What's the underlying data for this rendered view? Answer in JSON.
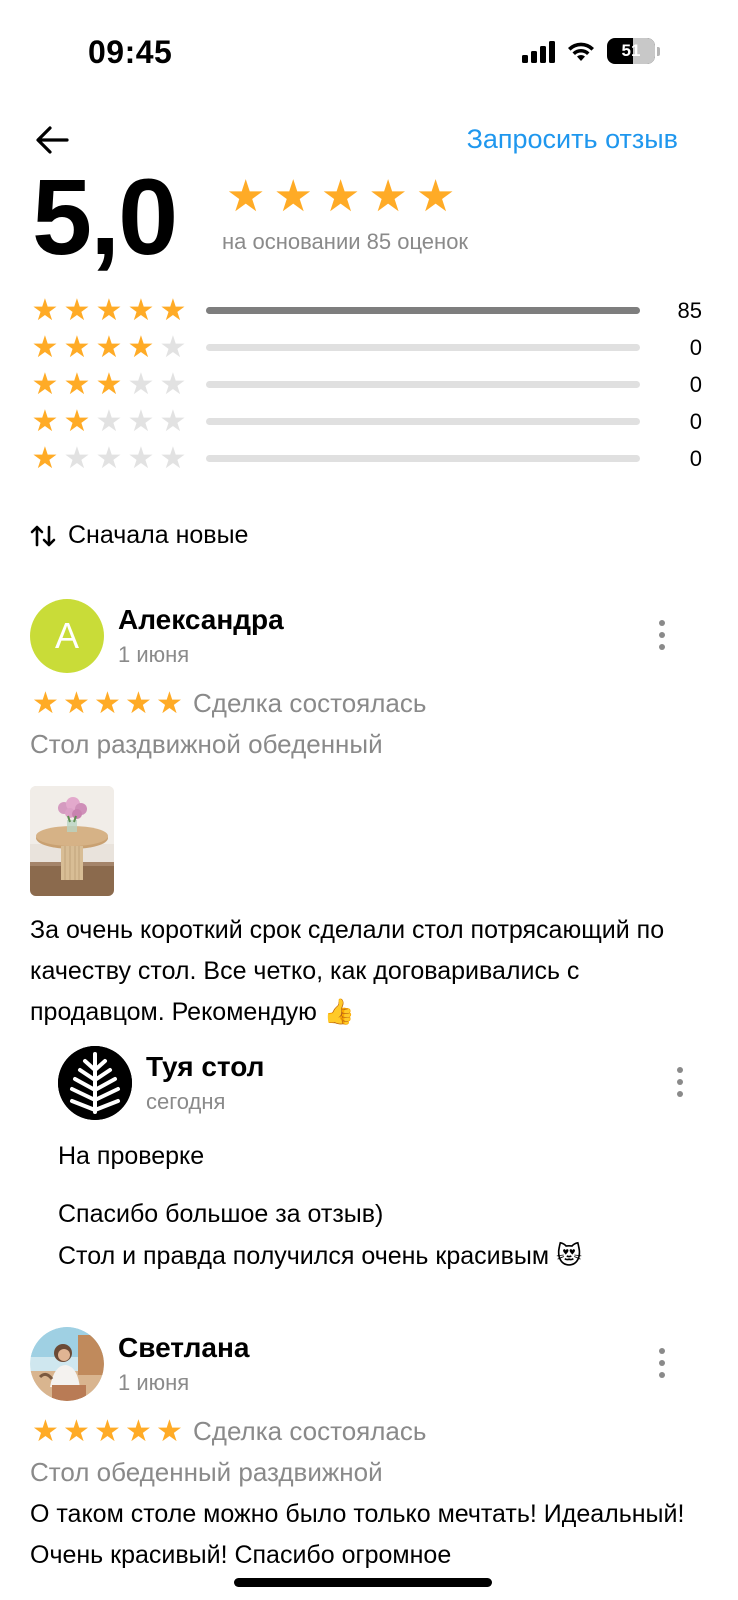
{
  "status_bar": {
    "time": "09:45",
    "battery": "51"
  },
  "header": {
    "request_review": "Запросить отзыв"
  },
  "summary": {
    "rating": "5,0",
    "stars": 5,
    "based_on": "на основании 85 оценок",
    "distribution": [
      {
        "stars": 5,
        "count": "85",
        "fraction": 1.0
      },
      {
        "stars": 4,
        "count": "0",
        "fraction": 0
      },
      {
        "stars": 3,
        "count": "0",
        "fraction": 0
      },
      {
        "stars": 2,
        "count": "0",
        "fraction": 0
      },
      {
        "stars": 1,
        "count": "0",
        "fraction": 0
      }
    ]
  },
  "sort": {
    "label": "Сначала новые"
  },
  "reviews": [
    {
      "avatar_letter": "А",
      "avatar_color": "#c9dc38",
      "author": "Александра",
      "date": "1 июня",
      "rating": 5,
      "status": "Сделка состоялась",
      "product": "Стол раздвижной обеденный",
      "text": "За очень короткий срок сделали стол потрясающий по качеству стол. Все четко, как договаривались с продавцом. Рекомендую 👍",
      "reply": {
        "author": "Туя стол",
        "date": "сегодня",
        "moderation": "На проверке",
        "line1": "Спасибо большое за отзыв)",
        "line2": "Стол и правда получился очень красивым 😻"
      }
    },
    {
      "author": "Светлана",
      "date": "1 июня",
      "rating": 5,
      "status": "Сделка состоялась",
      "product": "Стол обеденный раздвижной",
      "text": "О таком столе можно было только мечтать! Идеальный! Очень красивый! Спасибо огромное"
    }
  ],
  "icons": {
    "back": "arrow-left-icon",
    "sort": "sort-arrows-icon",
    "more": "more-vertical-icon",
    "star": "star-icon"
  },
  "colors": {
    "accent": "#1f97ee",
    "star": "#ffab26",
    "star_empty": "#e2e2e2"
  }
}
